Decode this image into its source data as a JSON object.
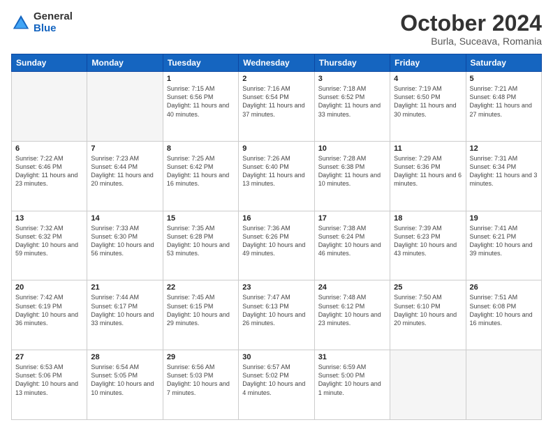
{
  "header": {
    "logo": {
      "general": "General",
      "blue": "Blue"
    },
    "title": "October 2024",
    "location": "Burla, Suceava, Romania"
  },
  "weekdays": [
    "Sunday",
    "Monday",
    "Tuesday",
    "Wednesday",
    "Thursday",
    "Friday",
    "Saturday"
  ],
  "weeks": [
    [
      {
        "day": "",
        "empty": true
      },
      {
        "day": "",
        "empty": true
      },
      {
        "day": "1",
        "sunrise": "Sunrise: 7:15 AM",
        "sunset": "Sunset: 6:56 PM",
        "daylight": "Daylight: 11 hours and 40 minutes."
      },
      {
        "day": "2",
        "sunrise": "Sunrise: 7:16 AM",
        "sunset": "Sunset: 6:54 PM",
        "daylight": "Daylight: 11 hours and 37 minutes."
      },
      {
        "day": "3",
        "sunrise": "Sunrise: 7:18 AM",
        "sunset": "Sunset: 6:52 PM",
        "daylight": "Daylight: 11 hours and 33 minutes."
      },
      {
        "day": "4",
        "sunrise": "Sunrise: 7:19 AM",
        "sunset": "Sunset: 6:50 PM",
        "daylight": "Daylight: 11 hours and 30 minutes."
      },
      {
        "day": "5",
        "sunrise": "Sunrise: 7:21 AM",
        "sunset": "Sunset: 6:48 PM",
        "daylight": "Daylight: 11 hours and 27 minutes."
      }
    ],
    [
      {
        "day": "6",
        "sunrise": "Sunrise: 7:22 AM",
        "sunset": "Sunset: 6:46 PM",
        "daylight": "Daylight: 11 hours and 23 minutes."
      },
      {
        "day": "7",
        "sunrise": "Sunrise: 7:23 AM",
        "sunset": "Sunset: 6:44 PM",
        "daylight": "Daylight: 11 hours and 20 minutes."
      },
      {
        "day": "8",
        "sunrise": "Sunrise: 7:25 AM",
        "sunset": "Sunset: 6:42 PM",
        "daylight": "Daylight: 11 hours and 16 minutes."
      },
      {
        "day": "9",
        "sunrise": "Sunrise: 7:26 AM",
        "sunset": "Sunset: 6:40 PM",
        "daylight": "Daylight: 11 hours and 13 minutes."
      },
      {
        "day": "10",
        "sunrise": "Sunrise: 7:28 AM",
        "sunset": "Sunset: 6:38 PM",
        "daylight": "Daylight: 11 hours and 10 minutes."
      },
      {
        "day": "11",
        "sunrise": "Sunrise: 7:29 AM",
        "sunset": "Sunset: 6:36 PM",
        "daylight": "Daylight: 11 hours and 6 minutes."
      },
      {
        "day": "12",
        "sunrise": "Sunrise: 7:31 AM",
        "sunset": "Sunset: 6:34 PM",
        "daylight": "Daylight: 11 hours and 3 minutes."
      }
    ],
    [
      {
        "day": "13",
        "sunrise": "Sunrise: 7:32 AM",
        "sunset": "Sunset: 6:32 PM",
        "daylight": "Daylight: 10 hours and 59 minutes."
      },
      {
        "day": "14",
        "sunrise": "Sunrise: 7:33 AM",
        "sunset": "Sunset: 6:30 PM",
        "daylight": "Daylight: 10 hours and 56 minutes."
      },
      {
        "day": "15",
        "sunrise": "Sunrise: 7:35 AM",
        "sunset": "Sunset: 6:28 PM",
        "daylight": "Daylight: 10 hours and 53 minutes."
      },
      {
        "day": "16",
        "sunrise": "Sunrise: 7:36 AM",
        "sunset": "Sunset: 6:26 PM",
        "daylight": "Daylight: 10 hours and 49 minutes."
      },
      {
        "day": "17",
        "sunrise": "Sunrise: 7:38 AM",
        "sunset": "Sunset: 6:24 PM",
        "daylight": "Daylight: 10 hours and 46 minutes."
      },
      {
        "day": "18",
        "sunrise": "Sunrise: 7:39 AM",
        "sunset": "Sunset: 6:23 PM",
        "daylight": "Daylight: 10 hours and 43 minutes."
      },
      {
        "day": "19",
        "sunrise": "Sunrise: 7:41 AM",
        "sunset": "Sunset: 6:21 PM",
        "daylight": "Daylight: 10 hours and 39 minutes."
      }
    ],
    [
      {
        "day": "20",
        "sunrise": "Sunrise: 7:42 AM",
        "sunset": "Sunset: 6:19 PM",
        "daylight": "Daylight: 10 hours and 36 minutes."
      },
      {
        "day": "21",
        "sunrise": "Sunrise: 7:44 AM",
        "sunset": "Sunset: 6:17 PM",
        "daylight": "Daylight: 10 hours and 33 minutes."
      },
      {
        "day": "22",
        "sunrise": "Sunrise: 7:45 AM",
        "sunset": "Sunset: 6:15 PM",
        "daylight": "Daylight: 10 hours and 29 minutes."
      },
      {
        "day": "23",
        "sunrise": "Sunrise: 7:47 AM",
        "sunset": "Sunset: 6:13 PM",
        "daylight": "Daylight: 10 hours and 26 minutes."
      },
      {
        "day": "24",
        "sunrise": "Sunrise: 7:48 AM",
        "sunset": "Sunset: 6:12 PM",
        "daylight": "Daylight: 10 hours and 23 minutes."
      },
      {
        "day": "25",
        "sunrise": "Sunrise: 7:50 AM",
        "sunset": "Sunset: 6:10 PM",
        "daylight": "Daylight: 10 hours and 20 minutes."
      },
      {
        "day": "26",
        "sunrise": "Sunrise: 7:51 AM",
        "sunset": "Sunset: 6:08 PM",
        "daylight": "Daylight: 10 hours and 16 minutes."
      }
    ],
    [
      {
        "day": "27",
        "sunrise": "Sunrise: 6:53 AM",
        "sunset": "Sunset: 5:06 PM",
        "daylight": "Daylight: 10 hours and 13 minutes."
      },
      {
        "day": "28",
        "sunrise": "Sunrise: 6:54 AM",
        "sunset": "Sunset: 5:05 PM",
        "daylight": "Daylight: 10 hours and 10 minutes."
      },
      {
        "day": "29",
        "sunrise": "Sunrise: 6:56 AM",
        "sunset": "Sunset: 5:03 PM",
        "daylight": "Daylight: 10 hours and 7 minutes."
      },
      {
        "day": "30",
        "sunrise": "Sunrise: 6:57 AM",
        "sunset": "Sunset: 5:02 PM",
        "daylight": "Daylight: 10 hours and 4 minutes."
      },
      {
        "day": "31",
        "sunrise": "Sunrise: 6:59 AM",
        "sunset": "Sunset: 5:00 PM",
        "daylight": "Daylight: 10 hours and 1 minute."
      },
      {
        "day": "",
        "empty": true
      },
      {
        "day": "",
        "empty": true
      }
    ]
  ]
}
